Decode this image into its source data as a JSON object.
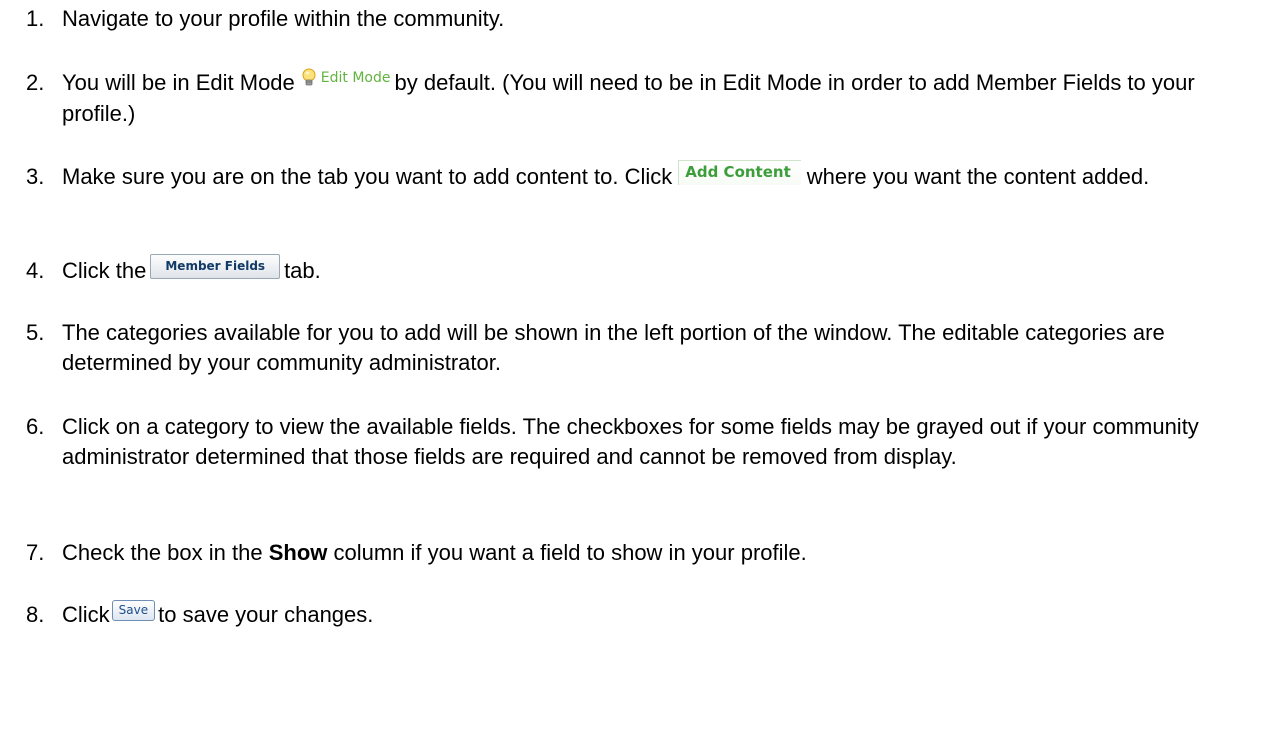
{
  "steps": [
    {
      "num": "1.",
      "text": "Navigate to your profile within the community."
    },
    {
      "num": "2.",
      "pre": "You will be in Edit Mode",
      "icon_label": "Edit Mode",
      "icon": "lightbulb-icon",
      "post": "by default. (You will need to be in Edit Mode in order to add Member Fields to your profile.)"
    },
    {
      "num": "3.",
      "pre": "Make sure you are on the tab you want to add content to. Click",
      "button_label": "Add Content",
      "post": "where you want the content added."
    },
    {
      "num": "4.",
      "pre": "Click the",
      "tab_label": "Member Fields",
      "post": "tab."
    },
    {
      "num": "5.",
      "text": "The categories available for you to add will be shown in the left portion of the window. The editable categories are determined by your community administrator."
    },
    {
      "num": "6.",
      "text": "Click on a category to view the available fields. The checkboxes for some fields may be grayed out if your community administrator determined that those fields are required and cannot be removed from display."
    },
    {
      "num": "7.",
      "pre": "Check the box in the",
      "bold": "Show",
      "post": "column if you want a field to show in your profile."
    },
    {
      "num": "8.",
      "pre": "Click",
      "button_label": "Save",
      "post": "to save your changes."
    }
  ],
  "colors": {
    "edit_mode_green": "#63b33f",
    "add_content_green": "#3c9e3a",
    "member_fields_text": "#123a66",
    "save_text": "#1f4f8a"
  }
}
